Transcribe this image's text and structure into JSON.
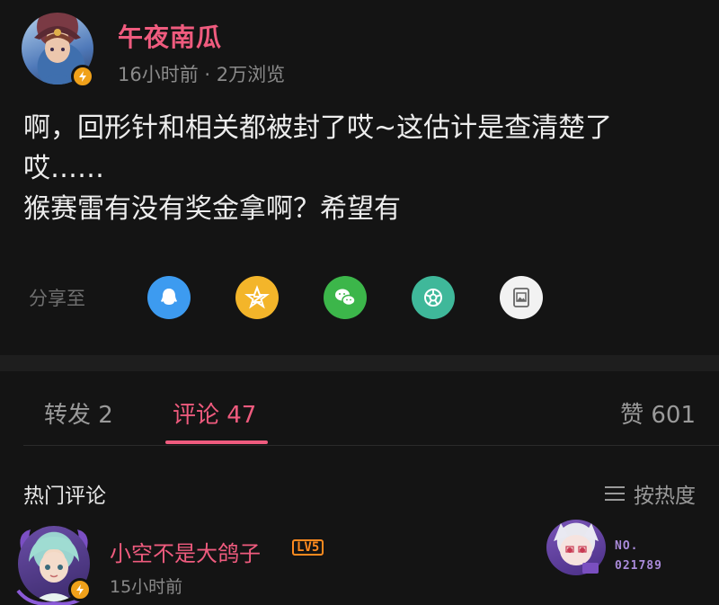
{
  "post": {
    "author": "午夜南瓜",
    "meta": "16小时前 · 2万浏览",
    "content_lines": [
      "啊，回形针和相关都被封了哎~这估计是查清楚了",
      "哎……",
      "猴赛雷有没有奖金拿啊？希望有"
    ]
  },
  "share": {
    "label": "分享至",
    "targets": [
      {
        "icon": "qq-icon",
        "color": "#3d9bf0"
      },
      {
        "icon": "qzone-icon",
        "color": "#f3b52a"
      },
      {
        "icon": "wechat-icon",
        "color": "#3cb64a"
      },
      {
        "icon": "moments-icon",
        "color": "#3fb89a"
      },
      {
        "icon": "save-image-icon",
        "color": "#f2f2f2"
      }
    ]
  },
  "tabs": {
    "repost": "转发 2",
    "comments": "评论 47",
    "likes": "赞 601"
  },
  "comments": {
    "header": "热门评论",
    "sort_label": "按热度",
    "items": [
      {
        "name": "小空不是大鸽子",
        "level": "LV5",
        "time": "15小时前",
        "fan_no_label": "NO.",
        "fan_no": "021789"
      }
    ]
  },
  "colors": {
    "accent": "#ef5b7e",
    "background": "#141414",
    "level": "#ff8a1f"
  }
}
